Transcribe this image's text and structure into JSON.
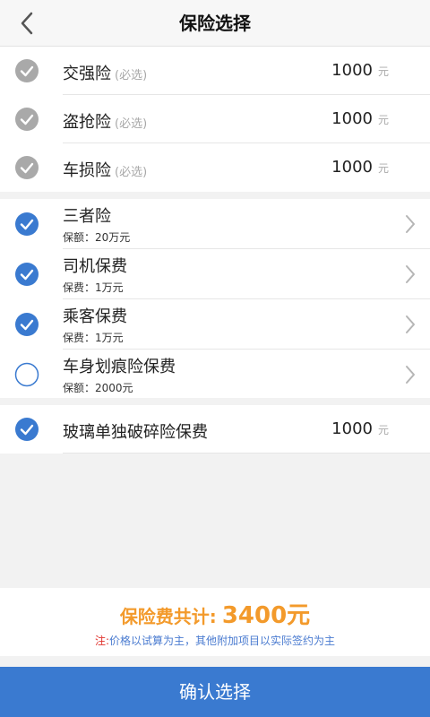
{
  "header": {
    "title": "保险选择"
  },
  "required_items": [
    {
      "name": "交强险",
      "tag": "(必选)",
      "price": "1000",
      "unit": "元"
    },
    {
      "name": "盗抢险",
      "tag": "(必选)",
      "price": "1000",
      "unit": "元"
    },
    {
      "name": "车损险",
      "tag": "(必选)",
      "price": "1000",
      "unit": "元"
    }
  ],
  "optional_items": [
    {
      "name": "三者险",
      "detail": "保额：20万元",
      "checked": true
    },
    {
      "name": "司机保费",
      "detail": "保费：1万元",
      "checked": true
    },
    {
      "name": "乘客保费",
      "detail": "保费：1万元",
      "checked": true
    },
    {
      "name": "车身划痕险保费",
      "detail": "保额：2000元",
      "checked": false
    }
  ],
  "glass_item": {
    "name": "玻璃单独破碎险保费",
    "price": "1000",
    "unit": "元",
    "checked": true
  },
  "summary": {
    "total_label": "保险费共计:",
    "total_amount": "3400元",
    "note_label": "注:",
    "note_text": "价格以试算为主，其他附加项目以实际签约为主"
  },
  "confirm_label": "确认选择",
  "colors": {
    "accent": "#3a7ad0",
    "total": "#f39a2b",
    "note_label": "#e0322c",
    "disabled_check": "#a9a9a9"
  },
  "icons": {
    "back": "chevron-left-icon",
    "check": "checkmark-circle-icon",
    "disclosure": "chevron-right-icon"
  }
}
